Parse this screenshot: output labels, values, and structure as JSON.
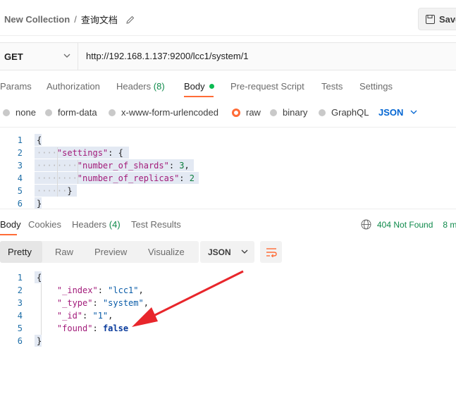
{
  "header": {
    "collection": "New Collection",
    "separator": "/",
    "request_name": "查询文档",
    "save_label": "Save"
  },
  "request": {
    "method": "GET",
    "url": "http://192.168.1.137:9200/lcc1/system/1"
  },
  "request_tabs": [
    {
      "label": "Params"
    },
    {
      "label": "Authorization"
    },
    {
      "label": "Headers",
      "count": "(8)"
    },
    {
      "label": "Body"
    },
    {
      "label": "Pre-request Script"
    },
    {
      "label": "Tests"
    },
    {
      "label": "Settings"
    }
  ],
  "body_types": [
    "none",
    "form-data",
    "x-www-form-urlencoded",
    "raw",
    "binary",
    "GraphQL"
  ],
  "body_format": "JSON",
  "request_body": {
    "line_numbers": [
      "1",
      "2",
      "3",
      "4",
      "5",
      "6"
    ],
    "settings_key": "\"settings\"",
    "shards_key": "\"number_of_shards\"",
    "shards_val": "3",
    "replicas_key": "\"number_of_replicas\"",
    "replicas_val": "2"
  },
  "response_tabs": [
    {
      "label": "Body"
    },
    {
      "label": "Cookies"
    },
    {
      "label": "Headers",
      "count": "(4)"
    },
    {
      "label": "Test Results"
    }
  ],
  "response_status": {
    "code": "404 Not Found",
    "time": "8 m"
  },
  "view_modes": [
    "Pretty",
    "Raw",
    "Preview",
    "Visualize"
  ],
  "response_format": "JSON",
  "response_body": {
    "line_numbers": [
      "1",
      "2",
      "3",
      "4",
      "5",
      "6"
    ],
    "index_key": "\"_index\"",
    "index_val": "\"lcc1\"",
    "type_key": "\"_type\"",
    "type_val": "\"system\"",
    "id_key": "\"_id\"",
    "id_val": "\"1\"",
    "found_key": "\"found\"",
    "found_val": "false"
  },
  "colors": {
    "accent": "#ff6c37",
    "success": "#0f8a4b",
    "link_blue": "#0265d2",
    "arrow_red": "#e8262b"
  }
}
